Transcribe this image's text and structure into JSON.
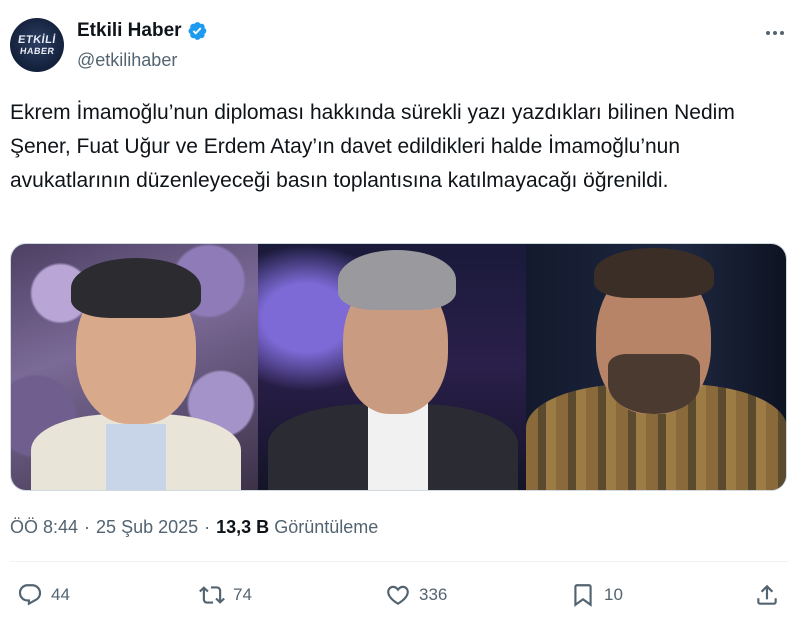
{
  "author": {
    "avatar_text_line1": "ETKİLİ",
    "avatar_text_line2": "HABER",
    "display_name": "Etkili Haber",
    "handle": "@etkilihaber",
    "verified": true
  },
  "tweet": {
    "text": "Ekrem İmamoğlu’nun diploması hakkında sürekli yazı yazdıkları bilinen Nedim Şener, Fuat Uğur ve Erdem Atay’ın davet edildikleri halde İmamoğlu’nun avukatlarının düzenleyeceği basın toplantısına katılmayacağı öğrenildi."
  },
  "meta": {
    "time": "ÖÖ 8:44",
    "date": "25 Şub 2025",
    "views_count": "13,3 B",
    "views_label": "Görüntüleme"
  },
  "actions": {
    "replies": "44",
    "reposts": "74",
    "likes": "336",
    "bookmarks": "10"
  },
  "colors": {
    "verified": "#1d9bf0",
    "secondary_text": "#536471",
    "primary_text": "#0f1419"
  }
}
